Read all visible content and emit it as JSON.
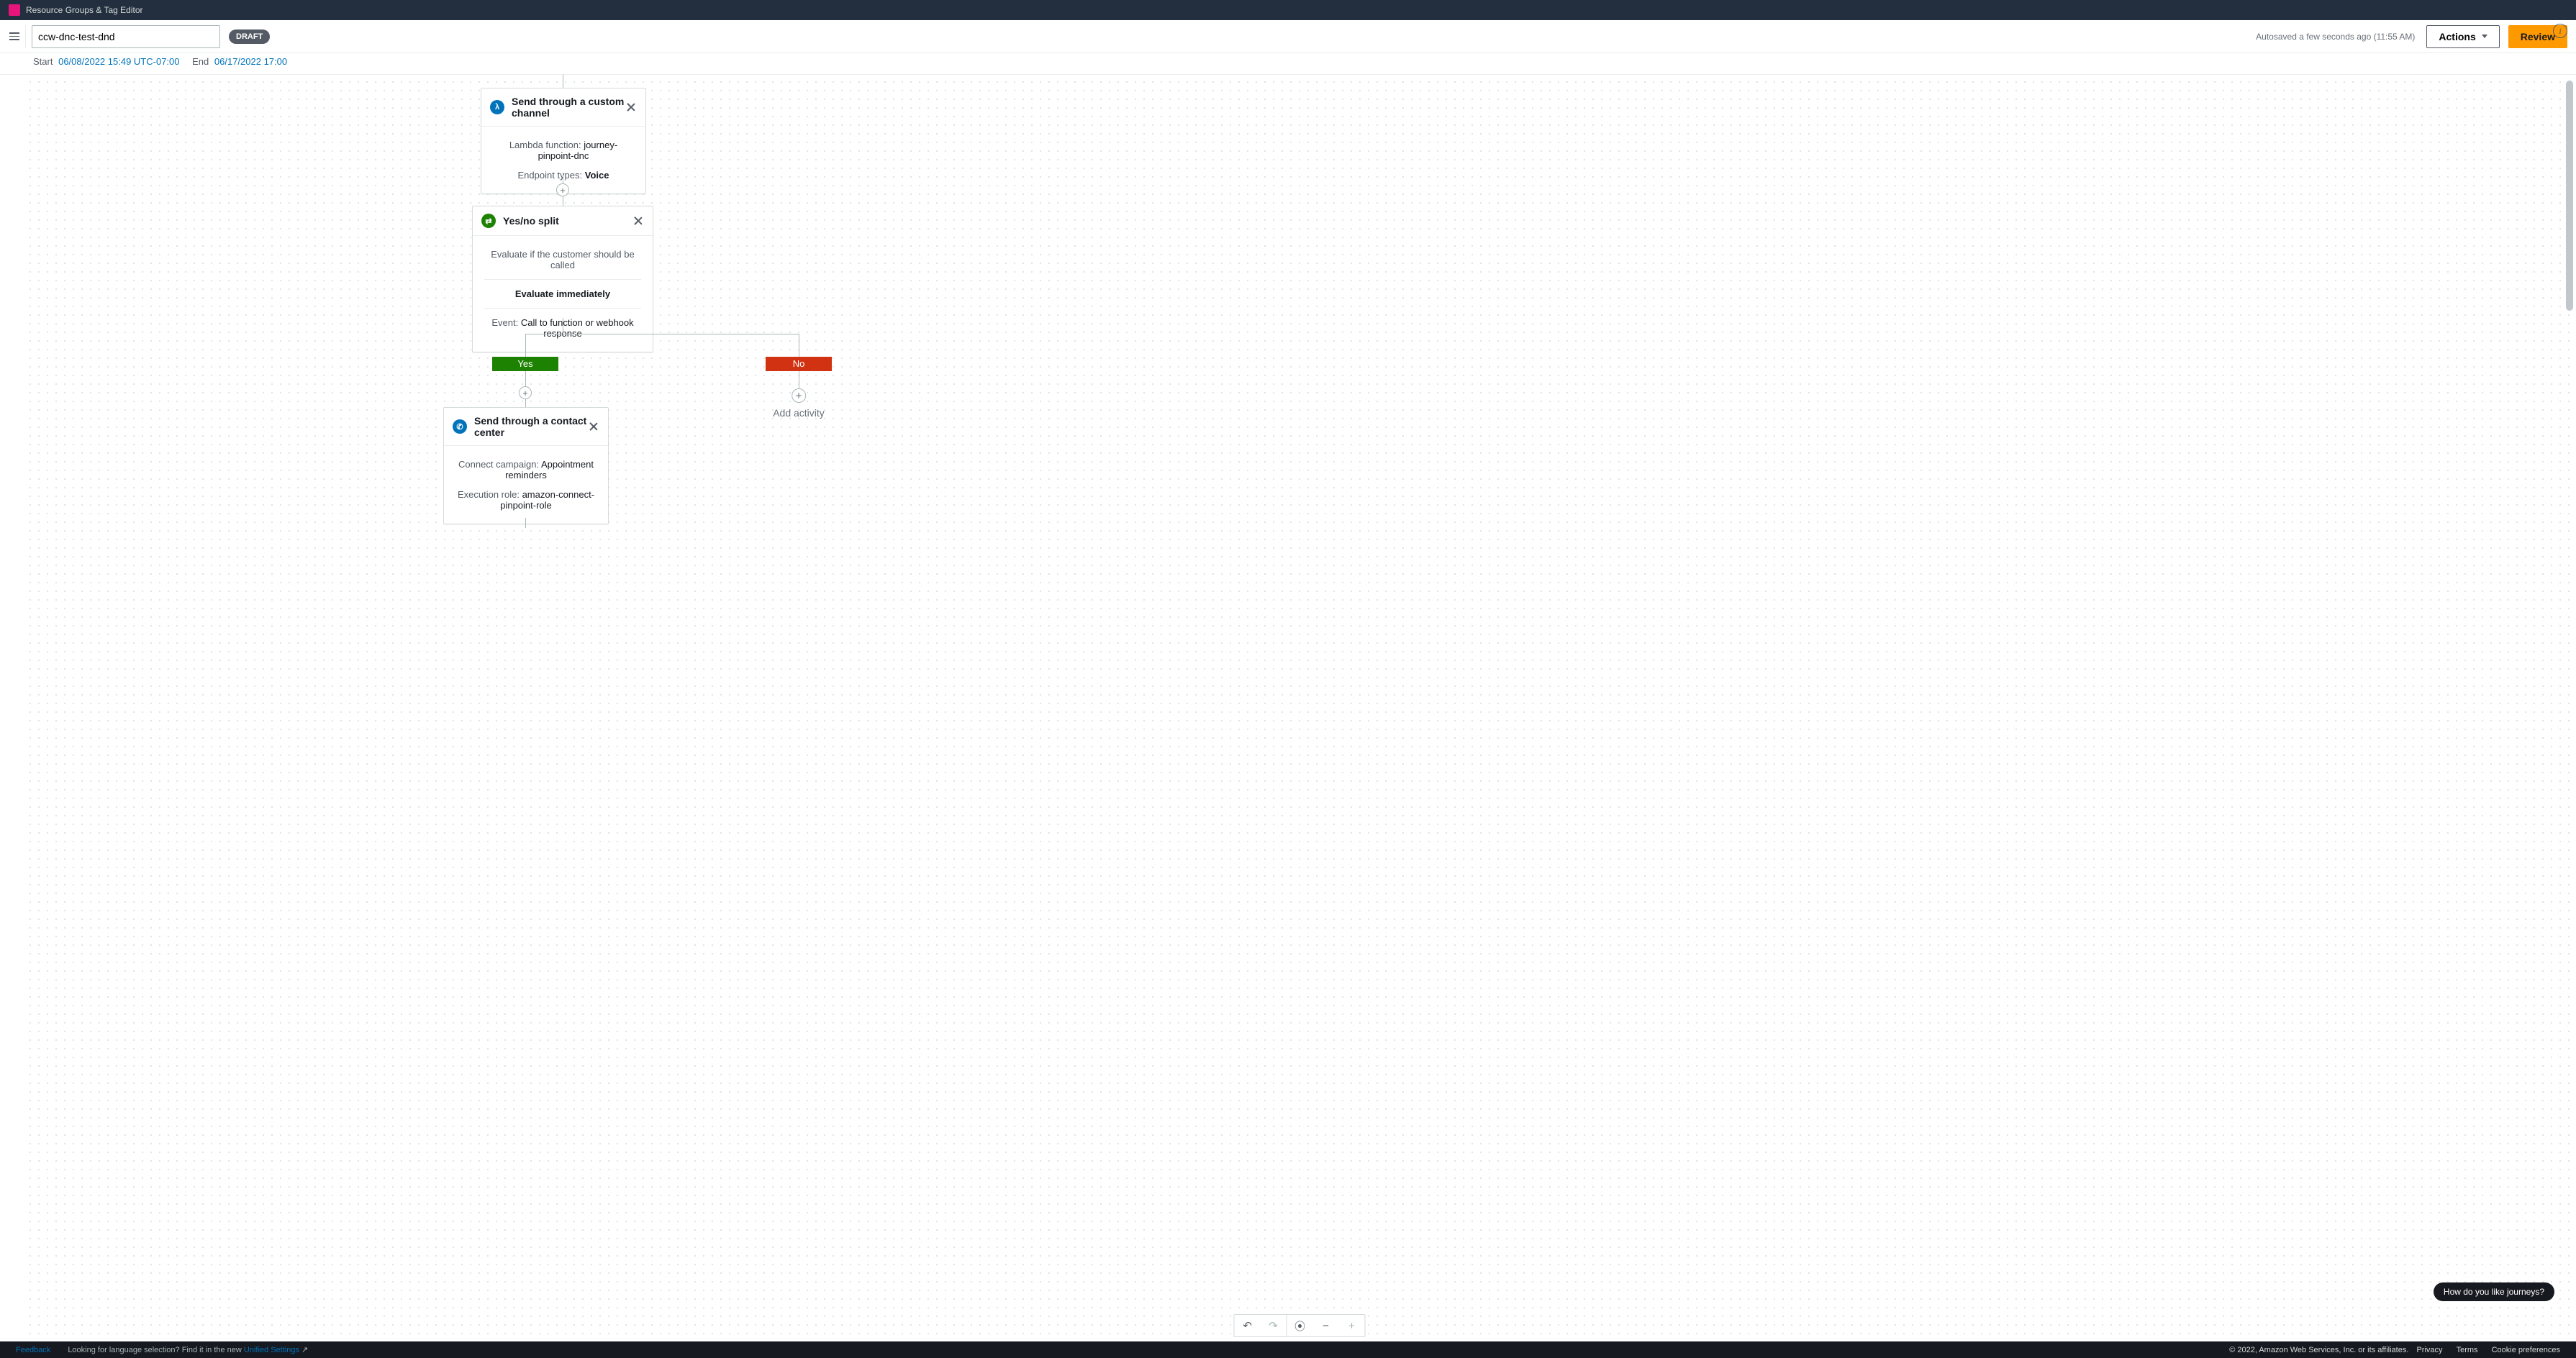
{
  "service_bar": {
    "label": "Resource Groups & Tag Editor"
  },
  "header": {
    "title_value": "ccw-dnc-test-dnd",
    "status_badge": "DRAFT",
    "autosave": "Autosaved a few seconds ago (11:55 AM)",
    "actions_label": "Actions",
    "review_label": "Review"
  },
  "dates": {
    "start_label": "Start",
    "start_value": "06/08/2022 15:49 UTC-07:00",
    "end_label": "End",
    "end_value": "06/17/2022 17:00"
  },
  "nodes": {
    "custom": {
      "title": "Send through a custom channel",
      "icon": "lambda-icon",
      "lambda_label": "Lambda function:",
      "lambda_value": "journey-pinpoint-dnc",
      "endpoint_label": "Endpoint types:",
      "endpoint_value": "Voice"
    },
    "split": {
      "title": "Yes/no split",
      "icon": "split-icon",
      "desc": "Evaluate if the customer should be called",
      "evaluate": "Evaluate immediately",
      "event_label": "Event:",
      "event_value": "Call to function or webhook response"
    },
    "contact": {
      "title": "Send through a contact center",
      "icon": "phone-icon",
      "campaign_label": "Connect campaign:",
      "campaign_value": "Appointment reminders",
      "role_label": "Execution role:",
      "role_value": "amazon-connect-pinpoint-role"
    },
    "branch_yes": "Yes",
    "branch_no": "No",
    "add_activity": "Add activity"
  },
  "feedback_pill": "How do you like journeys?",
  "footer": {
    "feedback": "Feedback",
    "lang_msg_a": "Looking for language selection? Find it in the new ",
    "lang_msg_b": "Unified Settings",
    "copyright": "© 2022, Amazon Web Services, Inc. or its affiliates.",
    "privacy": "Privacy",
    "terms": "Terms",
    "cookies": "Cookie preferences"
  },
  "tools": {
    "undo": "↶",
    "redo": "↷",
    "locate": "⦿",
    "minus": "−",
    "plus": "+"
  }
}
